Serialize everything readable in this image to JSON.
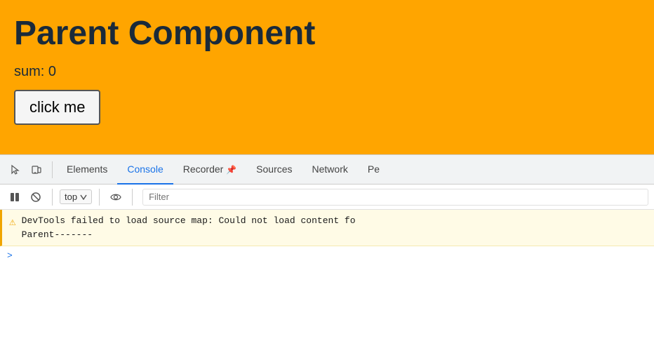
{
  "app": {
    "title": "Parent Component",
    "sum_label": "sum: 0",
    "click_button_label": "click me"
  },
  "devtools": {
    "tabs": [
      {
        "id": "elements",
        "label": "Elements",
        "active": false
      },
      {
        "id": "console",
        "label": "Console",
        "active": true
      },
      {
        "id": "recorder",
        "label": "Recorder",
        "active": false
      },
      {
        "id": "sources",
        "label": "Sources",
        "active": false
      },
      {
        "id": "network",
        "label": "Network",
        "active": false
      },
      {
        "id": "pe",
        "label": "Pe",
        "active": false
      }
    ],
    "toolbar": {
      "context_label": "top",
      "filter_placeholder": "Filter"
    },
    "console_messages": [
      {
        "type": "warning",
        "text": "DevTools failed to load source map: Could not load content fo",
        "continuation": "Parent-------"
      }
    ],
    "arrow_symbol": ">"
  }
}
